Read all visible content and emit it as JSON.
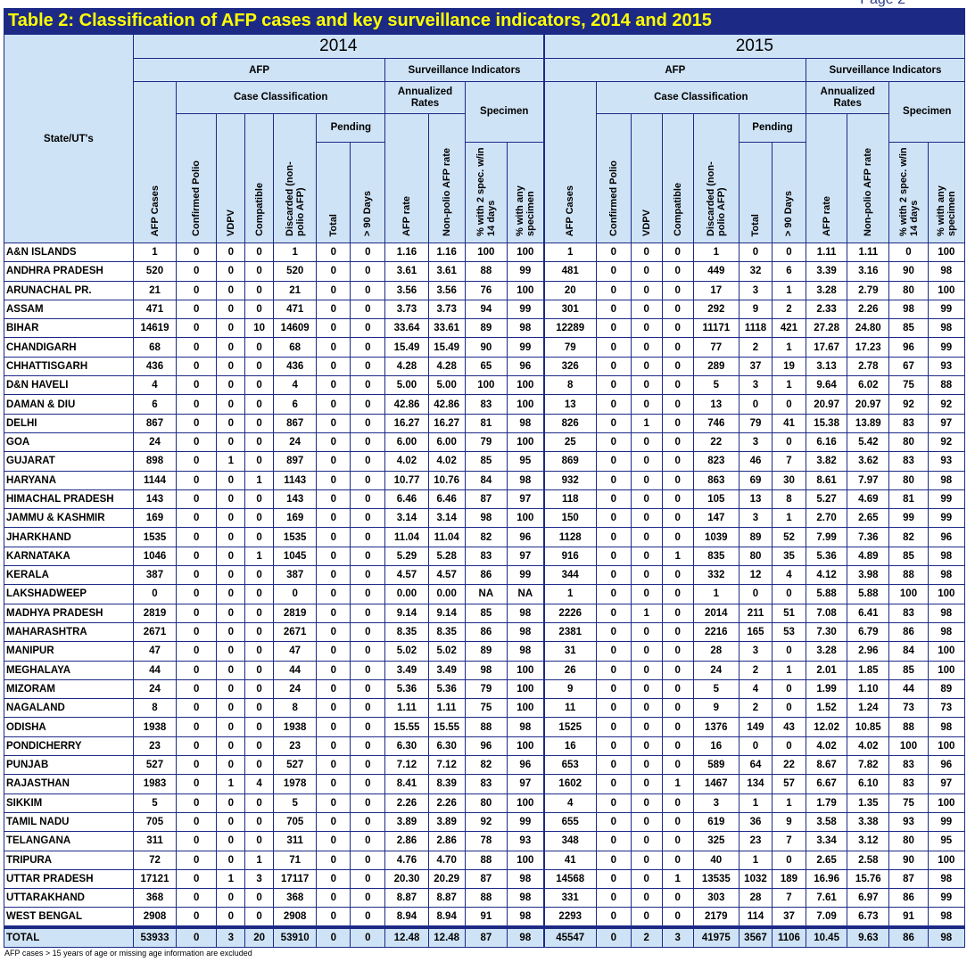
{
  "page_label": "Page 2",
  "title": "Table 2: Classification of AFP cases and key surveillance indicators, 2014 and 2015",
  "headers": {
    "state": "State/UT's",
    "afp": "AFP",
    "surveillance": "Surveillance Indicators",
    "case_classification": "Case Classification",
    "annualized_rates": "Annualized Rates",
    "specimen": "Specimen",
    "pending": "Pending",
    "afp_cases": "AFP Cases",
    "confirmed_polio": "Confirmed Polio",
    "vdpv": "VDPV",
    "compatible": "Compatible",
    "discarded": "Discarded (non-polio AFP)",
    "total": "Total",
    "gt90": "> 90 Days",
    "afp_rate": "AFP rate",
    "nonpolio_rate": "Non-polio AFP rate",
    "pct_2spec": "% with 2 spec. w/in 14 days",
    "pct_any": "% with any specimen"
  },
  "years": [
    "2014",
    "2015"
  ],
  "rows": [
    [
      "A&N ISLANDS",
      "1",
      "0",
      "0",
      "0",
      "1",
      "0",
      "0",
      "1.16",
      "1.16",
      "100",
      "100",
      "1",
      "0",
      "0",
      "0",
      "1",
      "0",
      "0",
      "1.11",
      "1.11",
      "0",
      "100"
    ],
    [
      "ANDHRA PRADESH",
      "520",
      "0",
      "0",
      "0",
      "520",
      "0",
      "0",
      "3.61",
      "3.61",
      "88",
      "99",
      "481",
      "0",
      "0",
      "0",
      "449",
      "32",
      "6",
      "3.39",
      "3.16",
      "90",
      "98"
    ],
    [
      "ARUNACHAL PR.",
      "21",
      "0",
      "0",
      "0",
      "21",
      "0",
      "0",
      "3.56",
      "3.56",
      "76",
      "100",
      "20",
      "0",
      "0",
      "0",
      "17",
      "3",
      "1",
      "3.28",
      "2.79",
      "80",
      "100"
    ],
    [
      "ASSAM",
      "471",
      "0",
      "0",
      "0",
      "471",
      "0",
      "0",
      "3.73",
      "3.73",
      "94",
      "99",
      "301",
      "0",
      "0",
      "0",
      "292",
      "9",
      "2",
      "2.33",
      "2.26",
      "98",
      "99"
    ],
    [
      "BIHAR",
      "14619",
      "0",
      "0",
      "10",
      "14609",
      "0",
      "0",
      "33.64",
      "33.61",
      "89",
      "98",
      "12289",
      "0",
      "0",
      "0",
      "11171",
      "1118",
      "421",
      "27.28",
      "24.80",
      "85",
      "98"
    ],
    [
      "CHANDIGARH",
      "68",
      "0",
      "0",
      "0",
      "68",
      "0",
      "0",
      "15.49",
      "15.49",
      "90",
      "99",
      "79",
      "0",
      "0",
      "0",
      "77",
      "2",
      "1",
      "17.67",
      "17.23",
      "96",
      "99"
    ],
    [
      "CHHATTISGARH",
      "436",
      "0",
      "0",
      "0",
      "436",
      "0",
      "0",
      "4.28",
      "4.28",
      "65",
      "96",
      "326",
      "0",
      "0",
      "0",
      "289",
      "37",
      "19",
      "3.13",
      "2.78",
      "67",
      "93"
    ],
    [
      "D&N HAVELI",
      "4",
      "0",
      "0",
      "0",
      "4",
      "0",
      "0",
      "5.00",
      "5.00",
      "100",
      "100",
      "8",
      "0",
      "0",
      "0",
      "5",
      "3",
      "1",
      "9.64",
      "6.02",
      "75",
      "88"
    ],
    [
      "DAMAN & DIU",
      "6",
      "0",
      "0",
      "0",
      "6",
      "0",
      "0",
      "42.86",
      "42.86",
      "83",
      "100",
      "13",
      "0",
      "0",
      "0",
      "13",
      "0",
      "0",
      "20.97",
      "20.97",
      "92",
      "92"
    ],
    [
      "DELHI",
      "867",
      "0",
      "0",
      "0",
      "867",
      "0",
      "0",
      "16.27",
      "16.27",
      "81",
      "98",
      "826",
      "0",
      "1",
      "0",
      "746",
      "79",
      "41",
      "15.38",
      "13.89",
      "83",
      "97"
    ],
    [
      "GOA",
      "24",
      "0",
      "0",
      "0",
      "24",
      "0",
      "0",
      "6.00",
      "6.00",
      "79",
      "100",
      "25",
      "0",
      "0",
      "0",
      "22",
      "3",
      "0",
      "6.16",
      "5.42",
      "80",
      "92"
    ],
    [
      "GUJARAT",
      "898",
      "0",
      "1",
      "0",
      "897",
      "0",
      "0",
      "4.02",
      "4.02",
      "85",
      "95",
      "869",
      "0",
      "0",
      "0",
      "823",
      "46",
      "7",
      "3.82",
      "3.62",
      "83",
      "93"
    ],
    [
      "HARYANA",
      "1144",
      "0",
      "0",
      "1",
      "1143",
      "0",
      "0",
      "10.77",
      "10.76",
      "84",
      "98",
      "932",
      "0",
      "0",
      "0",
      "863",
      "69",
      "30",
      "8.61",
      "7.97",
      "80",
      "98"
    ],
    [
      "HIMACHAL PRADESH",
      "143",
      "0",
      "0",
      "0",
      "143",
      "0",
      "0",
      "6.46",
      "6.46",
      "87",
      "97",
      "118",
      "0",
      "0",
      "0",
      "105",
      "13",
      "8",
      "5.27",
      "4.69",
      "81",
      "99"
    ],
    [
      "JAMMU & KASHMIR",
      "169",
      "0",
      "0",
      "0",
      "169",
      "0",
      "0",
      "3.14",
      "3.14",
      "98",
      "100",
      "150",
      "0",
      "0",
      "0",
      "147",
      "3",
      "1",
      "2.70",
      "2.65",
      "99",
      "99"
    ],
    [
      "JHARKHAND",
      "1535",
      "0",
      "0",
      "0",
      "1535",
      "0",
      "0",
      "11.04",
      "11.04",
      "82",
      "96",
      "1128",
      "0",
      "0",
      "0",
      "1039",
      "89",
      "52",
      "7.99",
      "7.36",
      "82",
      "96"
    ],
    [
      "KARNATAKA",
      "1046",
      "0",
      "0",
      "1",
      "1045",
      "0",
      "0",
      "5.29",
      "5.28",
      "83",
      "97",
      "916",
      "0",
      "0",
      "1",
      "835",
      "80",
      "35",
      "5.36",
      "4.89",
      "85",
      "98"
    ],
    [
      "KERALA",
      "387",
      "0",
      "0",
      "0",
      "387",
      "0",
      "0",
      "4.57",
      "4.57",
      "86",
      "99",
      "344",
      "0",
      "0",
      "0",
      "332",
      "12",
      "4",
      "4.12",
      "3.98",
      "88",
      "98"
    ],
    [
      "LAKSHADWEEP",
      "0",
      "0",
      "0",
      "0",
      "0",
      "0",
      "0",
      "0.00",
      "0.00",
      "NA",
      "NA",
      "1",
      "0",
      "0",
      "0",
      "1",
      "0",
      "0",
      "5.88",
      "5.88",
      "100",
      "100"
    ],
    [
      "MADHYA PRADESH",
      "2819",
      "0",
      "0",
      "0",
      "2819",
      "0",
      "0",
      "9.14",
      "9.14",
      "85",
      "98",
      "2226",
      "0",
      "1",
      "0",
      "2014",
      "211",
      "51",
      "7.08",
      "6.41",
      "83",
      "98"
    ],
    [
      "MAHARASHTRA",
      "2671",
      "0",
      "0",
      "0",
      "2671",
      "0",
      "0",
      "8.35",
      "8.35",
      "86",
      "98",
      "2381",
      "0",
      "0",
      "0",
      "2216",
      "165",
      "53",
      "7.30",
      "6.79",
      "86",
      "98"
    ],
    [
      "MANIPUR",
      "47",
      "0",
      "0",
      "0",
      "47",
      "0",
      "0",
      "5.02",
      "5.02",
      "89",
      "98",
      "31",
      "0",
      "0",
      "0",
      "28",
      "3",
      "0",
      "3.28",
      "2.96",
      "84",
      "100"
    ],
    [
      "MEGHALAYA",
      "44",
      "0",
      "0",
      "0",
      "44",
      "0",
      "0",
      "3.49",
      "3.49",
      "98",
      "100",
      "26",
      "0",
      "0",
      "0",
      "24",
      "2",
      "1",
      "2.01",
      "1.85",
      "85",
      "100"
    ],
    [
      "MIZORAM",
      "24",
      "0",
      "0",
      "0",
      "24",
      "0",
      "0",
      "5.36",
      "5.36",
      "79",
      "100",
      "9",
      "0",
      "0",
      "0",
      "5",
      "4",
      "0",
      "1.99",
      "1.10",
      "44",
      "89"
    ],
    [
      "NAGALAND",
      "8",
      "0",
      "0",
      "0",
      "8",
      "0",
      "0",
      "1.11",
      "1.11",
      "75",
      "100",
      "11",
      "0",
      "0",
      "0",
      "9",
      "2",
      "0",
      "1.52",
      "1.24",
      "73",
      "73"
    ],
    [
      "ODISHA",
      "1938",
      "0",
      "0",
      "0",
      "1938",
      "0",
      "0",
      "15.55",
      "15.55",
      "88",
      "98",
      "1525",
      "0",
      "0",
      "0",
      "1376",
      "149",
      "43",
      "12.02",
      "10.85",
      "88",
      "98"
    ],
    [
      "PONDICHERRY",
      "23",
      "0",
      "0",
      "0",
      "23",
      "0",
      "0",
      "6.30",
      "6.30",
      "96",
      "100",
      "16",
      "0",
      "0",
      "0",
      "16",
      "0",
      "0",
      "4.02",
      "4.02",
      "100",
      "100"
    ],
    [
      "PUNJAB",
      "527",
      "0",
      "0",
      "0",
      "527",
      "0",
      "0",
      "7.12",
      "7.12",
      "82",
      "96",
      "653",
      "0",
      "0",
      "0",
      "589",
      "64",
      "22",
      "8.67",
      "7.82",
      "83",
      "96"
    ],
    [
      "RAJASTHAN",
      "1983",
      "0",
      "1",
      "4",
      "1978",
      "0",
      "0",
      "8.41",
      "8.39",
      "83",
      "97",
      "1602",
      "0",
      "0",
      "1",
      "1467",
      "134",
      "57",
      "6.67",
      "6.10",
      "83",
      "97"
    ],
    [
      "SIKKIM",
      "5",
      "0",
      "0",
      "0",
      "5",
      "0",
      "0",
      "2.26",
      "2.26",
      "80",
      "100",
      "4",
      "0",
      "0",
      "0",
      "3",
      "1",
      "1",
      "1.79",
      "1.35",
      "75",
      "100"
    ],
    [
      "TAMIL NADU",
      "705",
      "0",
      "0",
      "0",
      "705",
      "0",
      "0",
      "3.89",
      "3.89",
      "92",
      "99",
      "655",
      "0",
      "0",
      "0",
      "619",
      "36",
      "9",
      "3.58",
      "3.38",
      "93",
      "99"
    ],
    [
      "TELANGANA",
      "311",
      "0",
      "0",
      "0",
      "311",
      "0",
      "0",
      "2.86",
      "2.86",
      "78",
      "93",
      "348",
      "0",
      "0",
      "0",
      "325",
      "23",
      "7",
      "3.34",
      "3.12",
      "80",
      "95"
    ],
    [
      "TRIPURA",
      "72",
      "0",
      "0",
      "1",
      "71",
      "0",
      "0",
      "4.76",
      "4.70",
      "88",
      "100",
      "41",
      "0",
      "0",
      "0",
      "40",
      "1",
      "0",
      "2.65",
      "2.58",
      "90",
      "100"
    ],
    [
      "UTTAR PRADESH",
      "17121",
      "0",
      "1",
      "3",
      "17117",
      "0",
      "0",
      "20.30",
      "20.29",
      "87",
      "98",
      "14568",
      "0",
      "0",
      "1",
      "13535",
      "1032",
      "189",
      "16.96",
      "15.76",
      "87",
      "98"
    ],
    [
      "UTTARAKHAND",
      "368",
      "0",
      "0",
      "0",
      "368",
      "0",
      "0",
      "8.87",
      "8.87",
      "88",
      "98",
      "331",
      "0",
      "0",
      "0",
      "303",
      "28",
      "7",
      "7.61",
      "6.97",
      "86",
      "99"
    ],
    [
      "WEST BENGAL",
      "2908",
      "0",
      "0",
      "0",
      "2908",
      "0",
      "0",
      "8.94",
      "8.94",
      "91",
      "98",
      "2293",
      "0",
      "0",
      "0",
      "2179",
      "114",
      "37",
      "7.09",
      "6.73",
      "91",
      "98"
    ]
  ],
  "total_row": [
    "TOTAL",
    "53933",
    "0",
    "3",
    "20",
    "53910",
    "0",
    "0",
    "12.48",
    "12.48",
    "87",
    "98",
    "45547",
    "0",
    "2",
    "3",
    "41975",
    "3567",
    "1106",
    "10.45",
    "9.63",
    "86",
    "98"
  ],
  "footnote": "AFP cases > 15 years of age or missing age information are excluded"
}
